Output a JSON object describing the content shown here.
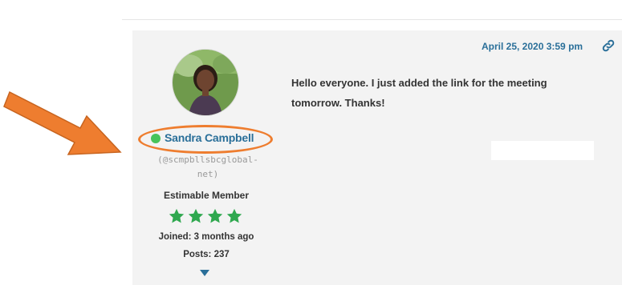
{
  "post": {
    "date": "April 25, 2020 3:59 pm",
    "content": "Hello everyone. I just added the link for the meeting tomorrow. Thanks!",
    "permalink_icon": "link-icon"
  },
  "author": {
    "name": "Sandra Campbell",
    "handle_line1": "(@scmpbllsbcglobal-",
    "handle_line2": "net)",
    "rank": "Estimable Member",
    "star_count": 4,
    "joined": "Joined: 3 months ago",
    "posts": "Posts: 237",
    "online_status_color": "#48c35a"
  },
  "annotation": {
    "arrow_color": "#ee7d2f",
    "circle_color": "#ee7d2f"
  },
  "colors": {
    "link": "#2a6f99",
    "star": "#2fa84f",
    "panel": "#f3f3f3"
  }
}
